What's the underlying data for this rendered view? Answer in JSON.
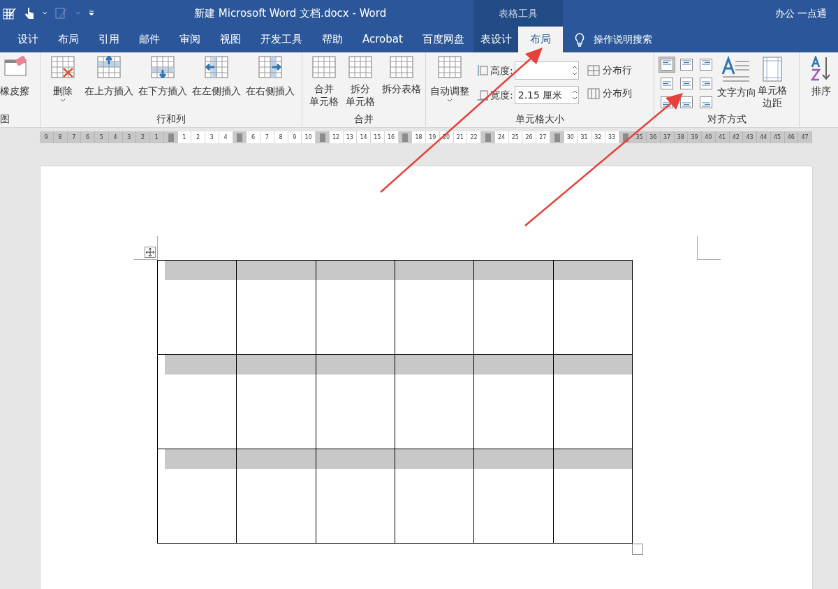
{
  "title_bar": {
    "document_title": "新建 Microsoft Word 文档.docx  -  Word",
    "contextual_group": "表格工具",
    "account": "办公 一点通"
  },
  "tabs": [
    {
      "label": "设计",
      "kind": "normal",
      "selected": false
    },
    {
      "label": "布局",
      "kind": "normal",
      "selected": false
    },
    {
      "label": "引用",
      "kind": "normal",
      "selected": false
    },
    {
      "label": "邮件",
      "kind": "normal",
      "selected": false
    },
    {
      "label": "审阅",
      "kind": "normal",
      "selected": false
    },
    {
      "label": "视图",
      "kind": "normal",
      "selected": false
    },
    {
      "label": "开发工具",
      "kind": "normal",
      "selected": false
    },
    {
      "label": "帮助",
      "kind": "normal",
      "selected": false
    },
    {
      "label": "Acrobat",
      "kind": "normal",
      "selected": false
    },
    {
      "label": "百度网盘",
      "kind": "normal",
      "selected": false
    },
    {
      "label": "表设计",
      "kind": "contextual",
      "selected": false
    },
    {
      "label": "布局",
      "kind": "contextual",
      "selected": true
    }
  ],
  "tell_me": "操作说明搜索",
  "ribbon": {
    "draw_group": {
      "button": "橡皮擦",
      "label": "图"
    },
    "rows_columns": {
      "label": "行和列",
      "delete": "删除",
      "inserts": [
        "在上方插入",
        "在下方插入",
        "在左侧插入",
        "在右侧插入"
      ]
    },
    "merge": {
      "label": "合并",
      "buttons": [
        [
          "合并",
          "单元格"
        ],
        [
          "拆分",
          "单元格"
        ],
        [
          "拆分表格"
        ]
      ]
    },
    "cell_size": {
      "label": "单元格大小",
      "autofit": "自动调整",
      "height_label": "高度:",
      "width_label": "宽度:",
      "width_value": "2.15 厘米",
      "distribute_rows": "分布行",
      "distribute_columns": "分布列"
    },
    "alignment": {
      "label": "对齐方式",
      "cells": [
        {
          "selected": true
        },
        {
          "selected": false
        },
        {
          "selected": false
        },
        {
          "selected": false
        },
        {
          "selected": false
        },
        {
          "selected": false
        },
        {
          "selected": false
        },
        {
          "selected": false
        },
        {
          "selected": false
        }
      ],
      "text_direction": "文字方向",
      "cell_margins": [
        "单元格",
        "边距"
      ]
    },
    "sort": "排序"
  },
  "ruler": {
    "segments": [
      {
        "shaded": true,
        "numbers": [
          "9",
          "8",
          "7",
          "6",
          "5",
          "4",
          "3",
          "2",
          "1"
        ]
      },
      {
        "shaded": false,
        "numbers": [
          "1",
          "2",
          "3",
          "4"
        ]
      },
      {
        "shaded": false,
        "numbers": [
          "6",
          "7",
          "8",
          "9",
          "10"
        ]
      },
      {
        "shaded": false,
        "numbers": [
          "12",
          "13",
          "14",
          "15",
          "16"
        ]
      },
      {
        "shaded": false,
        "numbers": [
          "18",
          "19",
          "20",
          "21",
          "22"
        ]
      },
      {
        "shaded": false,
        "numbers": [
          "24",
          "25",
          "26",
          "27"
        ]
      },
      {
        "shaded": false,
        "numbers": [
          "30",
          "31",
          "32",
          "33"
        ]
      },
      {
        "shaded": true,
        "numbers": [
          "35",
          "36",
          "37",
          "38",
          "39",
          "40",
          "41",
          "42",
          "43",
          "44",
          "45",
          "46",
          "47"
        ]
      }
    ]
  }
}
